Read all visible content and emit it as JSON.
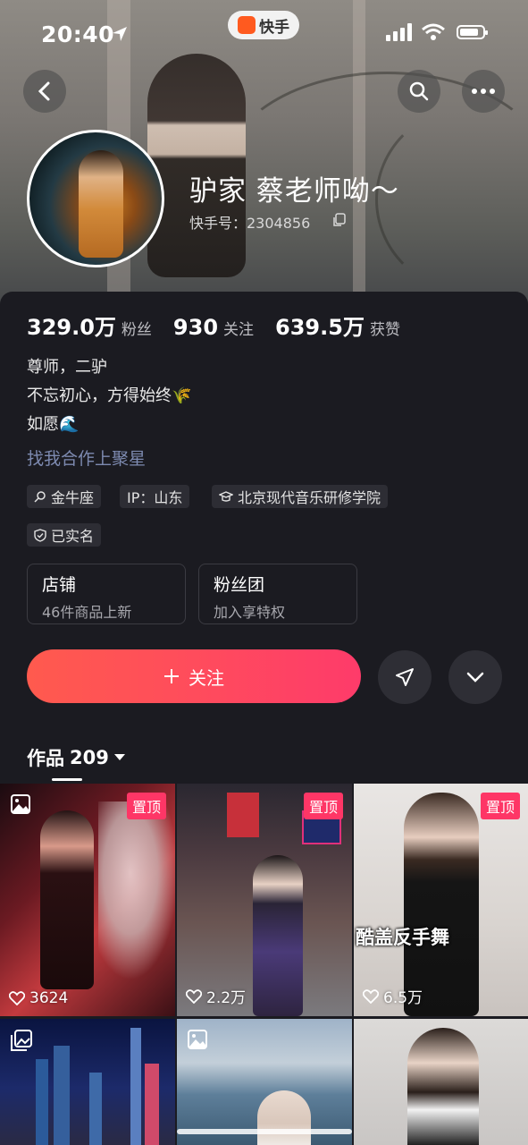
{
  "status_bar": {
    "time": "20:40",
    "app_name": "快手"
  },
  "profile": {
    "name": "驴家 蔡老师呦～",
    "user_id": "快手号：2304856"
  },
  "stats": [
    {
      "value": "329.0万",
      "label": "粉丝"
    },
    {
      "value": "930",
      "label": "关注"
    },
    {
      "value": "639.5万",
      "label": "获赞"
    }
  ],
  "bio": [
    "尊师，二驴",
    "不忘初心，方得始终🌾",
    "如愿🌊"
  ],
  "link_text": "找我合作上聚星",
  "tags": [
    "金牛座",
    "IP：山东",
    "北京现代音乐研修学院"
  ],
  "verified": "已实名",
  "cards": [
    {
      "title": "店铺",
      "subtitle": "46件商品上新"
    },
    {
      "title": "粉丝团",
      "subtitle": "加入享特权"
    }
  ],
  "follow_label": "关注",
  "works": {
    "label": "作品",
    "count": "209"
  },
  "grid": [
    {
      "pin": "置顶",
      "likes": "3624",
      "caption": ""
    },
    {
      "pin": "置顶",
      "likes": "2.2万",
      "caption": ""
    },
    {
      "pin": "置顶",
      "likes": "6.5万",
      "caption": "酷盖反手舞"
    }
  ],
  "colors": {
    "accent": "#fe3666",
    "follow_start": "#ff5a4e",
    "follow_end": "#fe3b6a",
    "panel_bg": "#1b1b21",
    "link": "#7d8ab0"
  }
}
